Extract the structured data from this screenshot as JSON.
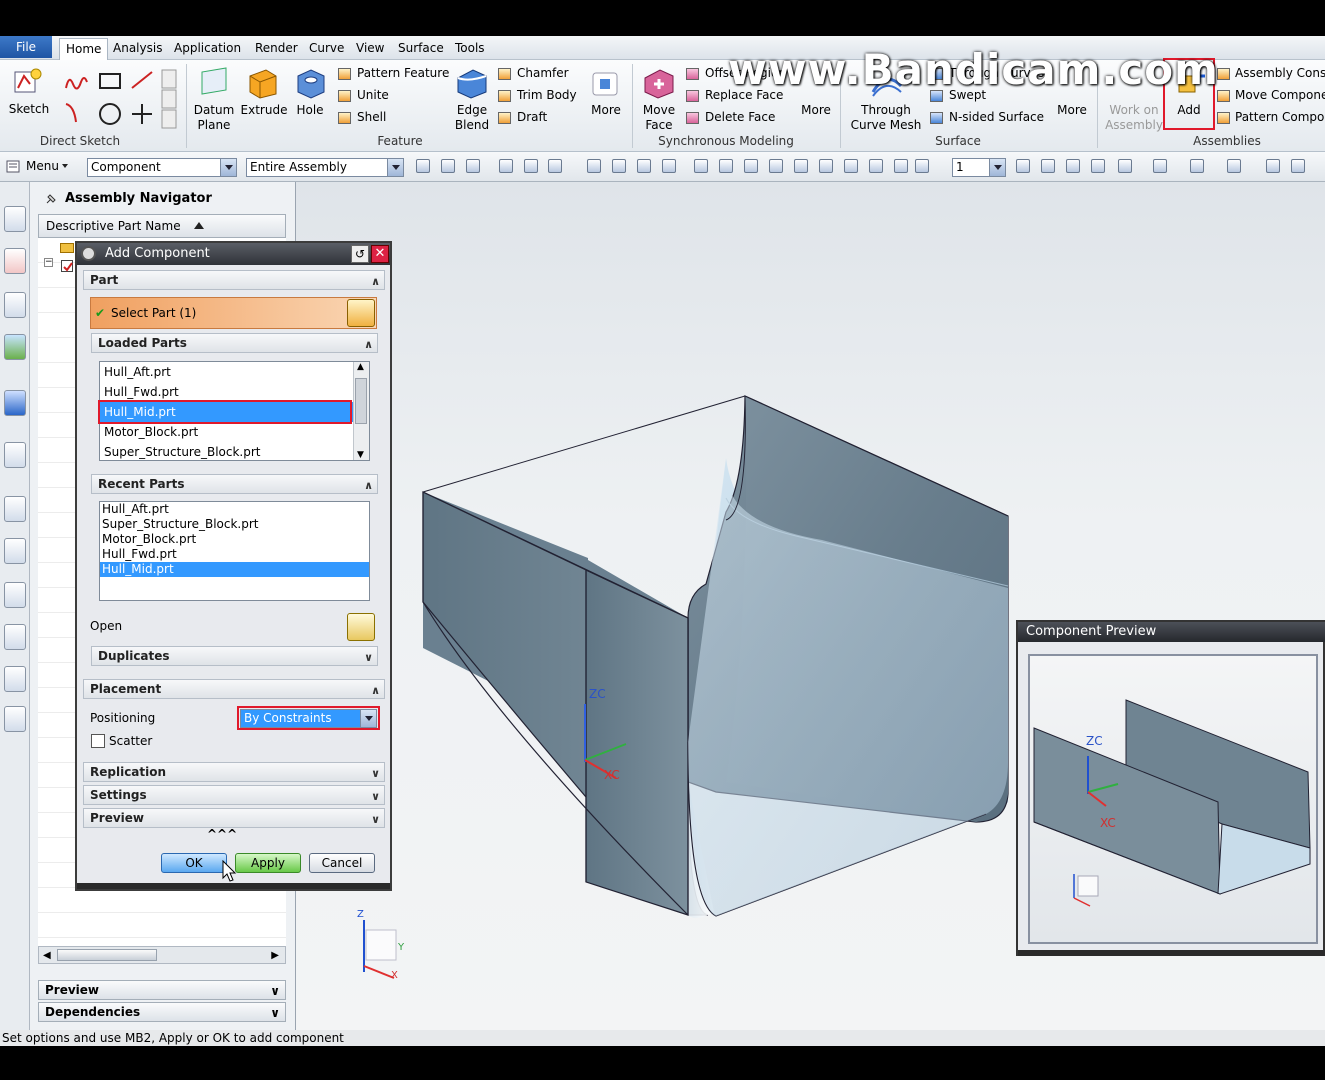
{
  "menubar": {
    "file": "File",
    "tabs": [
      "Home",
      "Analysis",
      "Application",
      "Render",
      "Curve",
      "View",
      "Surface",
      "Tools"
    ]
  },
  "ribbon": {
    "sketch": "Sketch",
    "direct_sketch": "Direct Sketch",
    "datum_plane": "Datum\nPlane",
    "extrude": "Extrude",
    "hole": "Hole",
    "pattern_feature": "Pattern Feature",
    "unite": "Unite",
    "shell": "Shell",
    "edge_blend": "Edge\nBlend",
    "chamfer": "Chamfer",
    "trim_body": "Trim Body",
    "draft": "Draft",
    "more1": "More",
    "feature": "Feature",
    "move_face": "Move\nFace",
    "offset_region": "Offset Region",
    "replace_face": "Replace Face",
    "delete_face": "Delete Face",
    "more2": "More",
    "synchronous_modeling": "Synchronous Modeling",
    "through_curve_mesh": "Through\nCurve Mesh",
    "through_curves": "Through Curves",
    "swept": "Swept",
    "n_sided_surface": "N-sided Surface",
    "more3": "More",
    "surface": "Surface",
    "work_on_assembly": "Work on\nAssembly",
    "add": "Add",
    "assembly_cons": "Assembly Cons",
    "move_compone": "Move Compone",
    "pattern_compo": "Pattern Compo",
    "assemblies": "Assemblies"
  },
  "toolbar": {
    "menu": "Menu",
    "filter": "Component",
    "scope": "Entire Assembly",
    "layer": "1"
  },
  "navigator": {
    "title": "Assembly Navigator",
    "column": "Descriptive Part Name",
    "preview": "Preview",
    "dependencies": "Dependencies"
  },
  "dialog": {
    "title": "Add Component",
    "part": "Part",
    "select_part": "Select Part (1)",
    "loaded_parts": "Loaded Parts",
    "loaded": [
      "Hull_Aft.prt",
      "Hull_Fwd.prt",
      "Hull_Mid.prt",
      "Motor_Block.prt",
      "Super_Structure_Block.prt"
    ],
    "recent_parts": "Recent Parts",
    "recent": [
      "Hull_Aft.prt",
      "Super_Structure_Block.prt",
      "Motor_Block.prt",
      "Hull_Fwd.prt",
      "Hull_Mid.prt"
    ],
    "open": "Open",
    "duplicates": "Duplicates",
    "placement": "Placement",
    "positioning": "Positioning",
    "positioning_value": "By Constraints",
    "scatter": "Scatter",
    "replication": "Replication",
    "settings": "Settings",
    "preview": "Preview",
    "ok": "OK",
    "apply": "Apply",
    "cancel": "Cancel"
  },
  "viewport": {
    "zc": "ZC",
    "xc": "XC",
    "z": "Z",
    "y": "Y",
    "x": "X"
  },
  "preview": {
    "title": "Component Preview",
    "zc": "ZC",
    "xc": "XC"
  },
  "status": "Set options and use MB2, Apply or OK to add component",
  "watermark": "www.Bandicam.com"
}
